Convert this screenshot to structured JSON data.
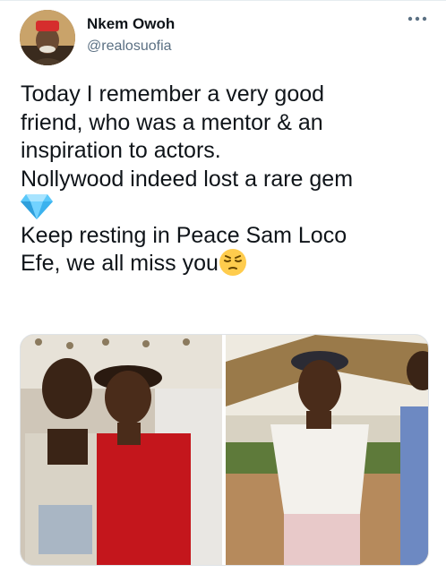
{
  "tweet": {
    "author_name": "Nkem Owoh",
    "author_handle": "@realosuofia",
    "more_icon": "more-horizontal-icon",
    "lines": [
      "Today I remember a very good",
      "friend, who was a mentor & an",
      "inspiration to actors.",
      "Nollywood indeed lost a rare gem",
      "",
      "Keep resting in Peace Sam Loco",
      "Efe, we all miss you"
    ],
    "emojis": [
      "gem-emoji",
      "pensive-face-emoji"
    ]
  },
  "media": {
    "photo_count": 2,
    "icons": [
      "photo-left",
      "photo-right"
    ]
  }
}
